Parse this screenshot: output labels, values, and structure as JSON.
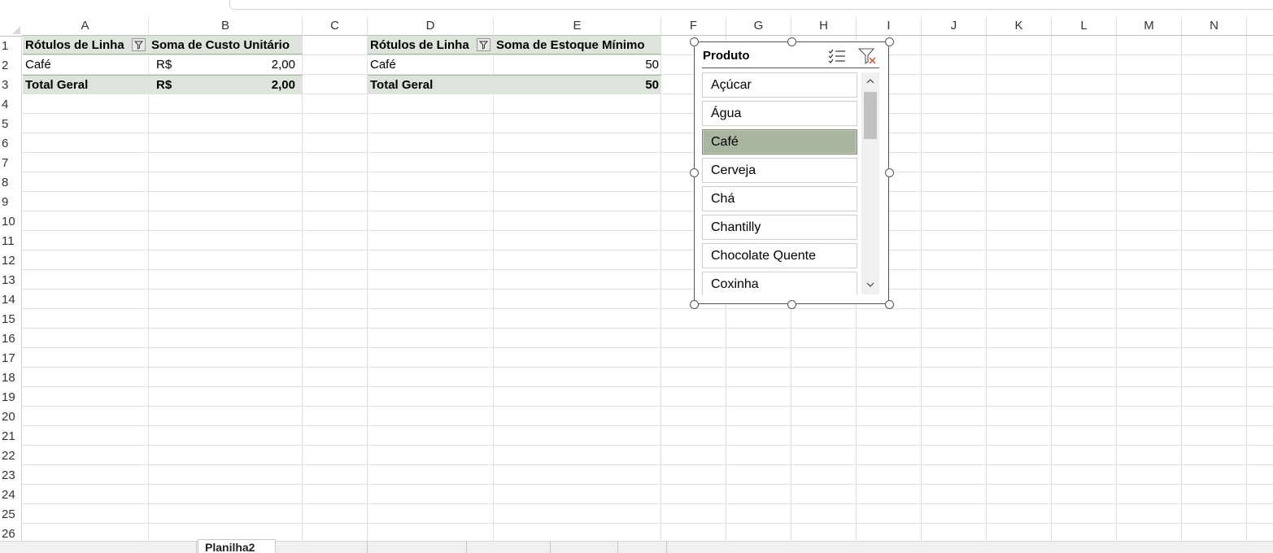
{
  "columns": [
    "A",
    "B",
    "C",
    "D",
    "E",
    "F",
    "G",
    "H",
    "I",
    "J",
    "K",
    "L",
    "M",
    "N"
  ],
  "rows": [
    "1",
    "2",
    "3",
    "4",
    "5",
    "6",
    "7",
    "8",
    "9",
    "10",
    "11",
    "12",
    "13",
    "14",
    "15",
    "16",
    "17",
    "18",
    "19",
    "20",
    "21",
    "22",
    "23",
    "24",
    "25",
    "26"
  ],
  "pivot1": {
    "header_label": "Rótulos de Linha",
    "header_value": "Soma de Custo Unitário",
    "row_label": "Café",
    "row_currency": "R$",
    "row_value": "2,00",
    "total_label": "Total Geral",
    "total_currency": "R$",
    "total_value": "2,00"
  },
  "pivot2": {
    "header_label": "Rótulos de Linha",
    "header_value": "Soma de Estoque Mínimo",
    "row_label": "Café",
    "row_value": "50",
    "total_label": "Total Geral",
    "total_value": "50"
  },
  "slicer": {
    "title": "Produto",
    "items": [
      {
        "label": "Açúcar",
        "selected": false
      },
      {
        "label": "Água",
        "selected": false
      },
      {
        "label": "Café",
        "selected": true
      },
      {
        "label": "Cerveja",
        "selected": false
      },
      {
        "label": "Chá",
        "selected": false
      },
      {
        "label": "Chantilly",
        "selected": false
      },
      {
        "label": "Chocolate Quente",
        "selected": false
      },
      {
        "label": "Coxinha",
        "selected": false
      }
    ],
    "multiselect_icon": "multi-select-icon",
    "clear_filter_icon": "clear-filter-icon"
  },
  "tabs": {
    "active_label": "Planilha2"
  },
  "colors": {
    "pivot_header_bg": "#dce4dc",
    "slicer_selected_bg": "#a9b59e",
    "clear_filter_x": "#d24726"
  }
}
